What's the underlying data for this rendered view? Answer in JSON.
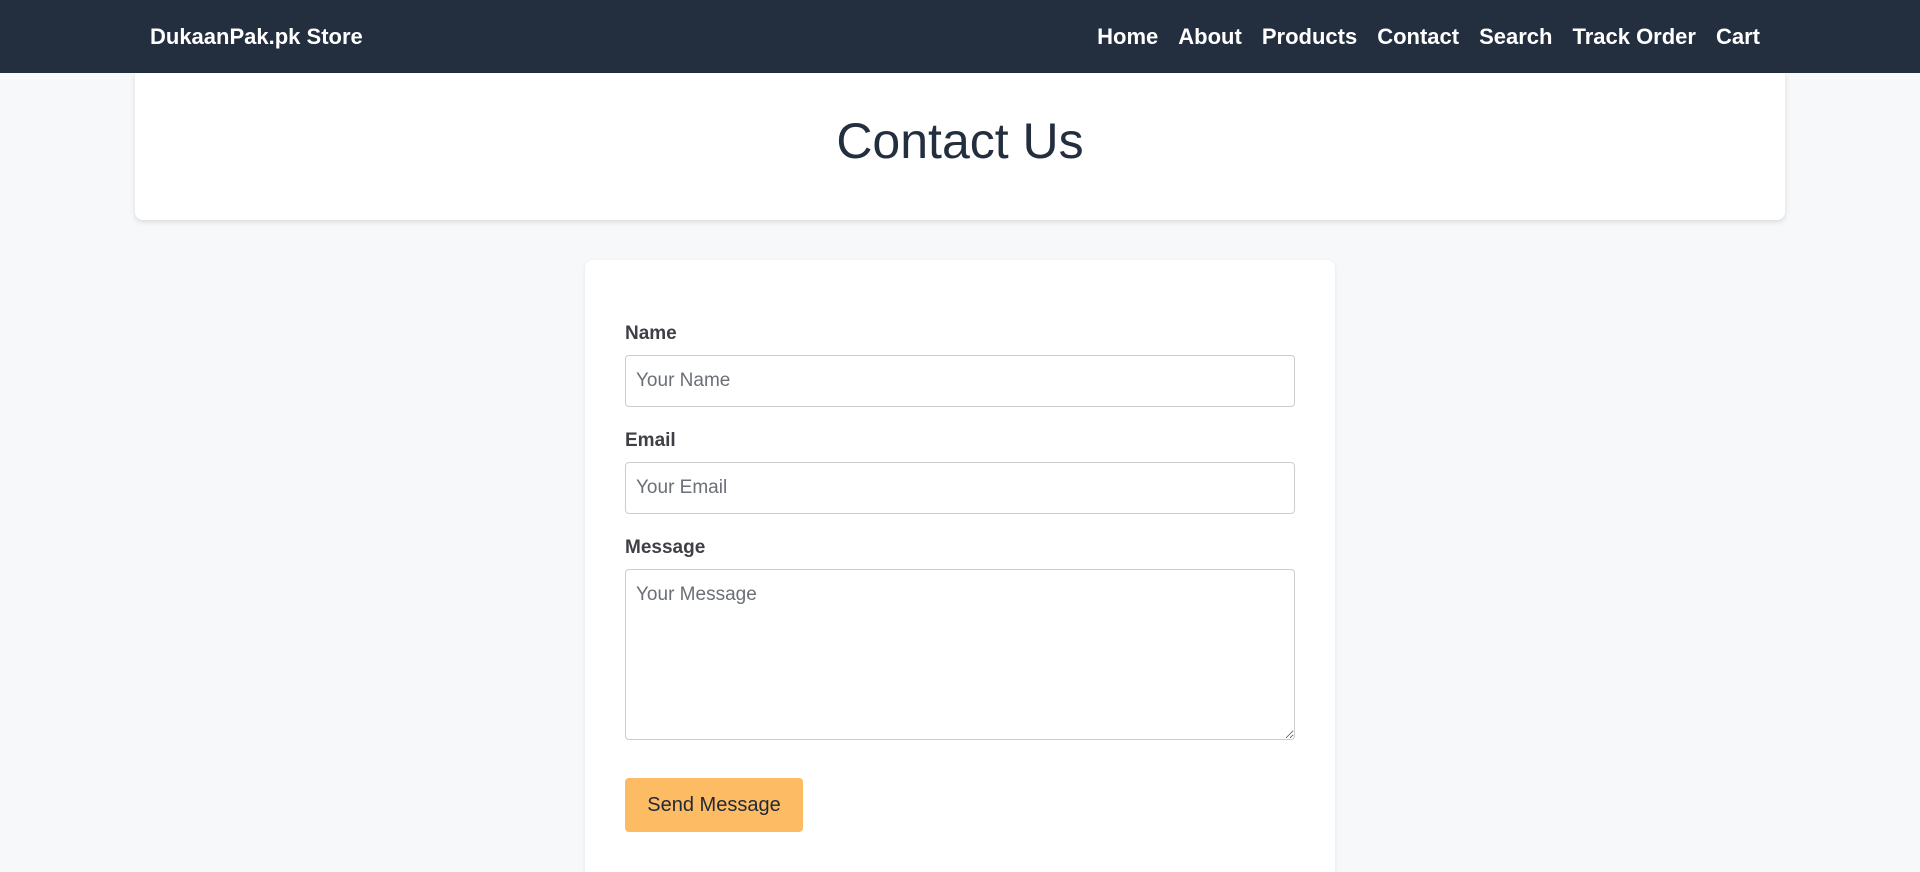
{
  "navbar": {
    "brand": "DukaanPak.pk Store",
    "links": [
      {
        "label": "Home"
      },
      {
        "label": "About"
      },
      {
        "label": "Products"
      },
      {
        "label": "Contact"
      },
      {
        "label": "Search"
      },
      {
        "label": "Track Order"
      },
      {
        "label": "Cart"
      }
    ],
    "background_color": "#232e3f"
  },
  "header": {
    "title": "Contact Us"
  },
  "form": {
    "name": {
      "label": "Name",
      "placeholder": "Your Name",
      "value": ""
    },
    "email": {
      "label": "Email",
      "placeholder": "Your Email",
      "value": ""
    },
    "message": {
      "label": "Message",
      "placeholder": "Your Message",
      "value": ""
    },
    "submit_label": "Send Message",
    "submit_color": "#fdbb63"
  }
}
